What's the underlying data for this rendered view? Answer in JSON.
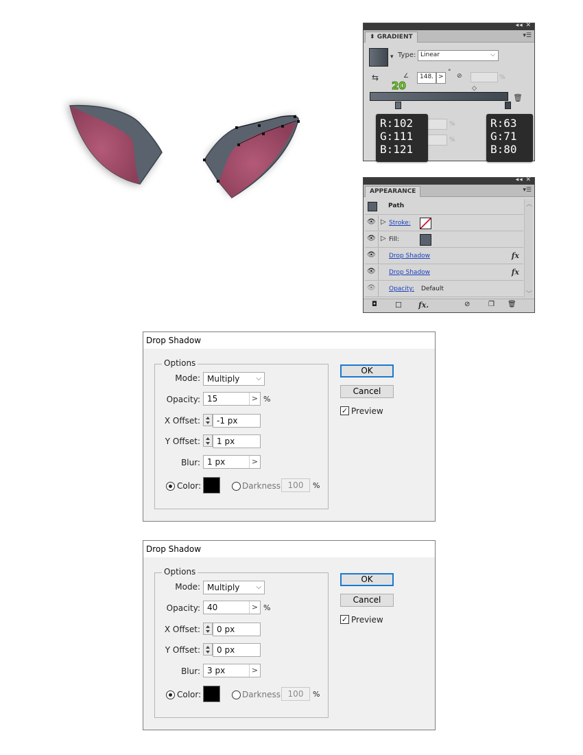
{
  "colors": {
    "ear_gray": "#5a636e",
    "ear_pink": "#a65470",
    "gradient_start": "#666f79",
    "gradient_end": "#3f4750"
  },
  "gradient_panel": {
    "tab": "GRADIENT",
    "type_label": "Type:",
    "type_value": "Linear",
    "angle_value": "148.",
    "degree_mark": "°",
    "aspect_value": "",
    "percent": "%",
    "badge_number": "20",
    "tooltip_left": [
      "R:102",
      "G:111",
      "B:121"
    ],
    "tooltip_right": [
      "R:63",
      "G:71",
      "B:80"
    ],
    "field1_percent": "%",
    "field2_percent": "%"
  },
  "appearance_panel": {
    "tab": "APPEARANCE",
    "path_label": "Path",
    "stroke_label": "Stroke:",
    "fill_label": "Fill:",
    "drop_shadow_1": "Drop Shadow",
    "drop_shadow_2": "Drop Shadow",
    "opacity_label": "Opacity:",
    "opacity_value": "Default",
    "fx_1": "fx",
    "fx_2": "fx",
    "fx_bottom": "fx."
  },
  "dialogs": [
    {
      "title": "Drop Shadow",
      "group": "Options",
      "mode_label": "Mode:",
      "mode_value": "Multiply",
      "opacity_label": "Opacity:",
      "opacity_value": "15",
      "opacity_unit": "%",
      "x_label": "X Offset:",
      "x_value": "-1 px",
      "y_label": "Y Offset:",
      "y_value": "1 px",
      "blur_label": "Blur:",
      "blur_value": "1 px",
      "color_label": "Color:",
      "darkness_label": "Darkness:",
      "darkness_value": "100",
      "darkness_unit": "%",
      "ok": "OK",
      "cancel": "Cancel",
      "preview": "Preview"
    },
    {
      "title": "Drop Shadow",
      "group": "Options",
      "mode_label": "Mode:",
      "mode_value": "Multiply",
      "opacity_label": "Opacity:",
      "opacity_value": "40",
      "opacity_unit": "%",
      "x_label": "X Offset:",
      "x_value": "0 px",
      "y_label": "Y Offset:",
      "y_value": "0 px",
      "blur_label": "Blur:",
      "blur_value": "3 px",
      "color_label": "Color:",
      "darkness_label": "Darkness:",
      "darkness_value": "100",
      "darkness_unit": "%",
      "ok": "OK",
      "cancel": "Cancel",
      "preview": "Preview"
    }
  ]
}
